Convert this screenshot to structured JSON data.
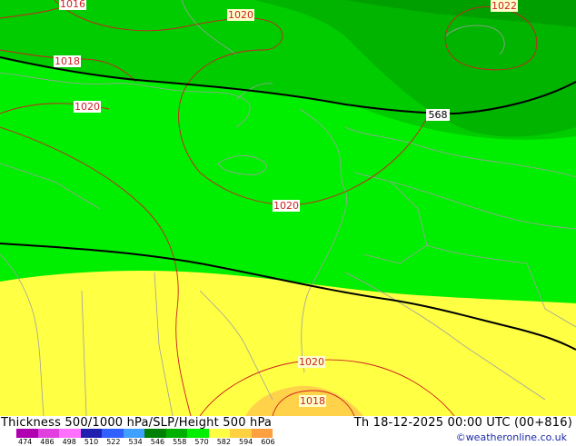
{
  "title": "Thickness 500/1000 hPa/SLP/Height 500 hPa",
  "valid_time": "Th 18-12-2025 00:00 UTC (00+816)",
  "credit": "©weatheronline.co.uk",
  "colors": {
    "green_light": "#00ee00",
    "green_mid": "#00cc00",
    "green_dark": "#00a800",
    "yellow": "#ffff44",
    "yellow_dark": "#ffd24a",
    "isobar": "#cc2020",
    "height_contour": "#000000",
    "borders": "#a0a0a0"
  },
  "isobar_labels": [
    "1016",
    "1020",
    "1022",
    "1018",
    "1020",
    "1020",
    "1020",
    "1018"
  ],
  "height_labels": [
    "568"
  ],
  "legend": {
    "ticks": [
      "474",
      "486",
      "498",
      "510",
      "522",
      "534",
      "546",
      "558",
      "570",
      "582",
      "594",
      "606"
    ],
    "colors": [
      "#b000b0",
      "#e040e0",
      "#ff70ff",
      "#2020b0",
      "#3060ff",
      "#40a0ff",
      "#008000",
      "#00b000",
      "#00ee00",
      "#ffff44",
      "#ffd040",
      "#ffa040"
    ]
  }
}
